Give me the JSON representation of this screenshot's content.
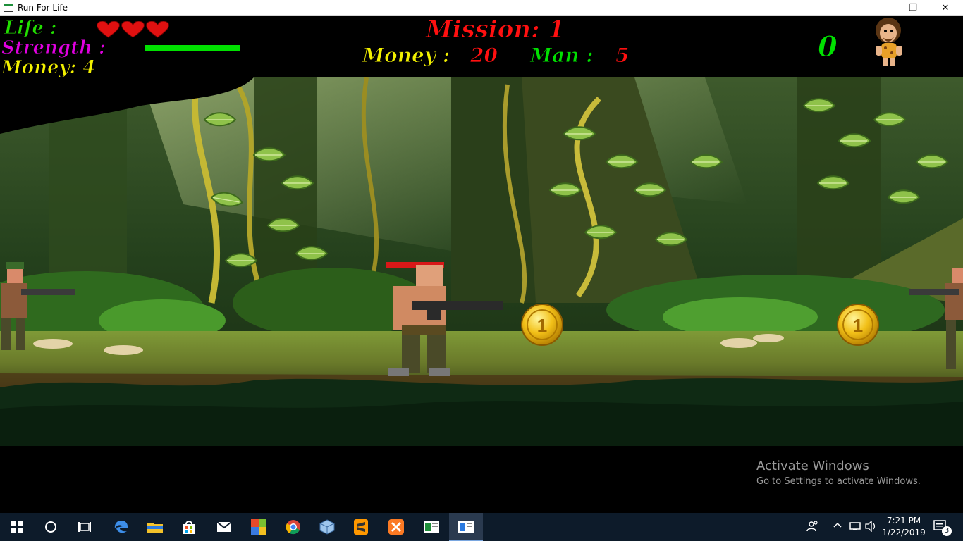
{
  "window": {
    "title": "Run For Life",
    "minimize_glyph": "—",
    "restore_glyph": "❐",
    "close_glyph": "✕"
  },
  "hud": {
    "life_label": "Life :",
    "lives": 3,
    "strength_label": "Strength :",
    "strength_level": 1.0,
    "money_label": "Money: 4",
    "mission_label": "Mission: 1",
    "money_total_label": "Money :",
    "money_total_value": "20",
    "man_label": "Man :",
    "man_value": "5",
    "score": "0",
    "colors": {
      "life": "#22e000",
      "strength": "#e000e0",
      "money": "#f2f000",
      "mission": "#ff1010",
      "heart": "#e01010",
      "strength_bar": "#00e000",
      "score": "#00e000"
    }
  },
  "scene": {
    "coins": [
      {
        "name": "gold-coin-1",
        "glyph": "1"
      },
      {
        "name": "gold-coin-2",
        "glyph": "1"
      }
    ]
  },
  "watermark": {
    "line1": "Activate Windows",
    "line2": "Go to Settings to activate Windows."
  },
  "taskbar": {
    "icons": [
      "windows-start-icon",
      "cortana-search-icon",
      "task-view-icon",
      "edge-icon",
      "file-explorer-icon",
      "store-icon",
      "mail-icon",
      "minecraft-icon",
      "chrome-icon",
      "virtualbox-icon",
      "sublime-text-icon",
      "xampp-icon",
      "app-window-icon",
      "active-game-window-icon"
    ],
    "time": "7:21 PM",
    "date": "1/22/2019",
    "notifications": "3"
  }
}
